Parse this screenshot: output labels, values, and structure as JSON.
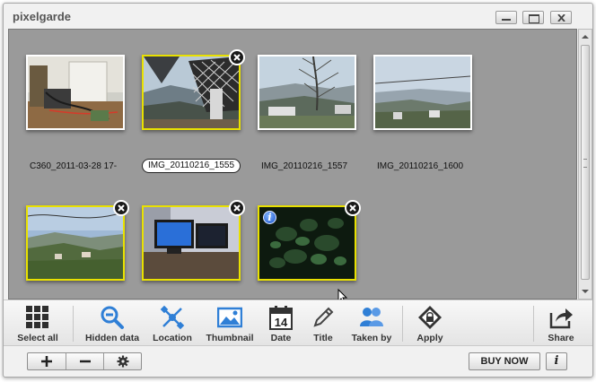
{
  "window": {
    "title": "pixelgarde"
  },
  "photos": [
    {
      "caption": "C360_2011-03-28 17-",
      "selected": false,
      "editing": false
    },
    {
      "caption": "IMG_20110216_1555",
      "selected": true,
      "editing": true
    },
    {
      "caption": "IMG_20110216_1557",
      "selected": false,
      "editing": false
    },
    {
      "caption": "IMG_20110216_1600",
      "selected": false,
      "editing": false
    },
    {
      "caption": "",
      "selected": true,
      "editing": false
    },
    {
      "caption": "",
      "selected": true,
      "editing": false
    },
    {
      "caption": "",
      "selected": true,
      "editing": false,
      "info": true
    }
  ],
  "toolbar": {
    "select_all": "Select all",
    "hidden_data": "Hidden data",
    "location": "Location",
    "thumbnail": "Thumbnail",
    "date": "Date",
    "date_icon_number": "14",
    "title": "Title",
    "taken_by": "Taken by",
    "apply": "Apply",
    "share": "Share"
  },
  "bottom": {
    "buy_now": "BUY NOW",
    "info": "i"
  },
  "colors": {
    "accent_blue": "#2f7fd6",
    "selection_yellow": "#e9e100",
    "gallery_bg": "#9a9a9a"
  },
  "icons": {
    "select_all": "grid-icon",
    "hidden_data": "magnifier-minus-icon",
    "location": "satellite-icon",
    "thumbnail": "picture-icon",
    "date": "calendar-icon",
    "title": "pencil-icon",
    "taken_by": "people-icon",
    "apply": "lock-diamond-icon",
    "share": "share-arrow-icon"
  }
}
